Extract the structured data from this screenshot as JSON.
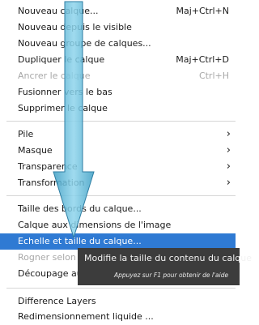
{
  "menu": {
    "items": [
      {
        "label": "Nouveau calque...",
        "shortcut": "Maj+Ctrl+N"
      },
      {
        "label": "Nouveau depuis le visible",
        "shortcut": ""
      },
      {
        "label": "Nouveau groupe de calques...",
        "shortcut": ""
      },
      {
        "label": "Dupliquer le calque",
        "shortcut": "Maj+Ctrl+D"
      },
      {
        "label": "Ancrer le calque",
        "shortcut": "Ctrl+H"
      },
      {
        "label": "Fusionner vers le bas",
        "shortcut": ""
      },
      {
        "label": "Supprimer le calque",
        "shortcut": ""
      },
      {
        "label": "Pile",
        "submenu": "›"
      },
      {
        "label": "Masque",
        "submenu": "›"
      },
      {
        "label": "Transparence",
        "submenu": "›"
      },
      {
        "label": "Transformation",
        "submenu": "›"
      },
      {
        "label": "Taille des bords du calque...",
        "shortcut": ""
      },
      {
        "label": "Calque aux dimensions de l'image",
        "shortcut": ""
      },
      {
        "label": "Echelle et taille du calque...",
        "shortcut": ""
      },
      {
        "label": "Rogner selon la sélection",
        "shortcut": ""
      },
      {
        "label": "Découpage automatique du calque",
        "shortcut": ""
      },
      {
        "label": "Difference Layers",
        "shortcut": ""
      },
      {
        "label": "Redimensionnement liquide ...",
        "shortcut": ""
      }
    ]
  },
  "tooltip": {
    "title": "Modifie la taille du contenu du calque",
    "help": "Appuyez sur F1 pour obtenir de l'aide"
  },
  "colors": {
    "highlight": "#2f7ad3",
    "tooltip_bg": "#3c3c3c",
    "arrow": "#4eb3d6"
  }
}
